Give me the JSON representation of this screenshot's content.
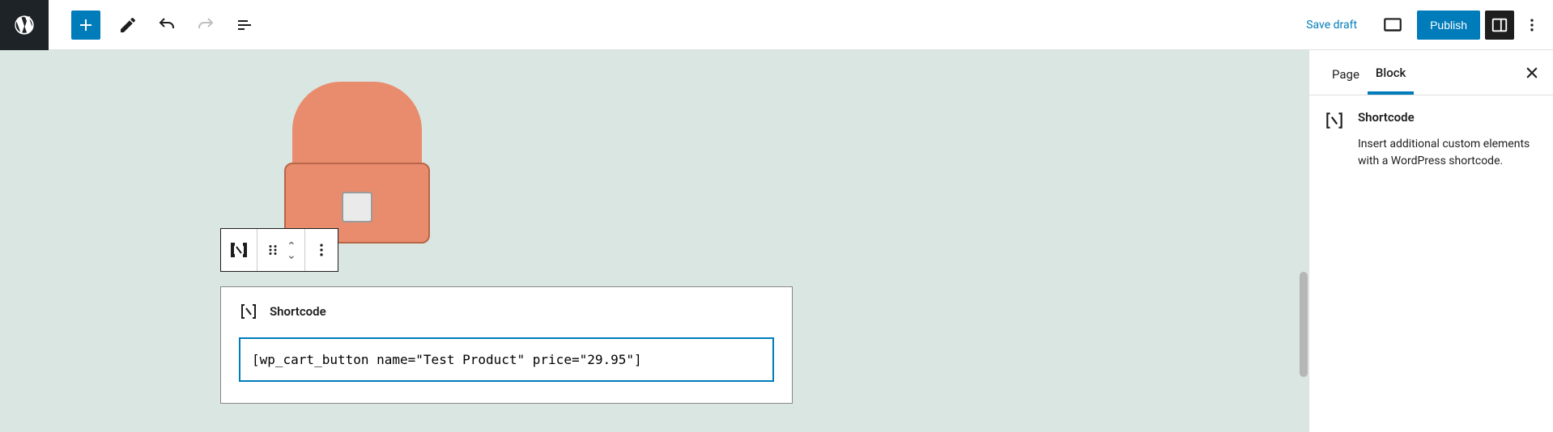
{
  "toolbar": {
    "save_draft": "Save draft",
    "publish": "Publish"
  },
  "sidebar": {
    "tabs": {
      "page": "Page",
      "block": "Block"
    },
    "block": {
      "title": "Shortcode",
      "description": "Insert additional custom elements with a WordPress shortcode."
    }
  },
  "editor": {
    "shortcode_block": {
      "label": "Shortcode",
      "value": "[wp_cart_button name=\"Test Product\" price=\"29.95\"]"
    }
  }
}
